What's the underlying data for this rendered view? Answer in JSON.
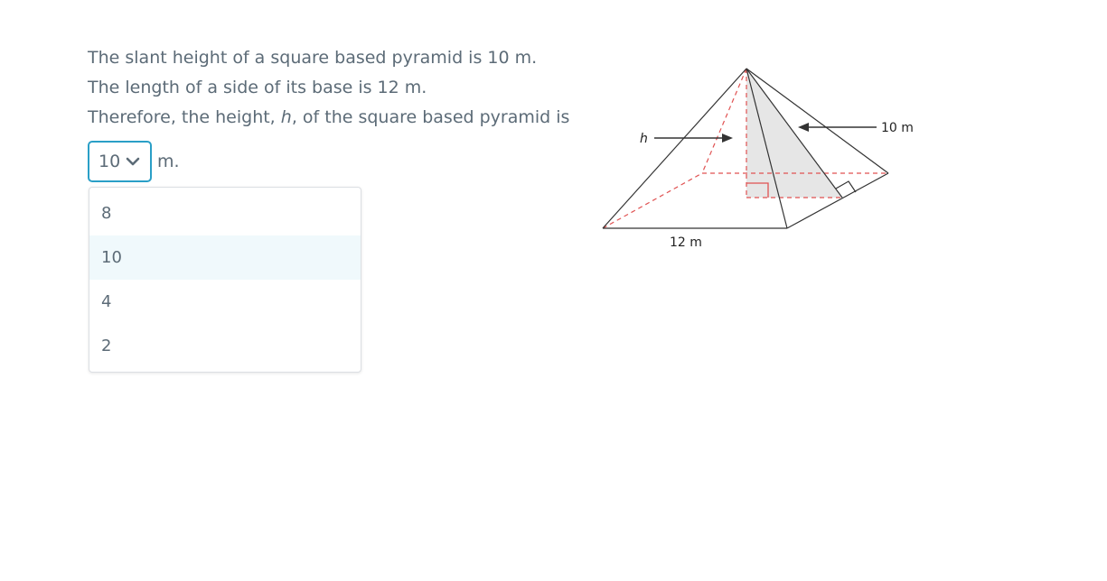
{
  "question": {
    "line1": "The slant height of a square based pyramid is 10 m.",
    "line2": "The length of a side of its base is 12 m.",
    "line3_prefix": "Therefore, the height, ",
    "line3_var": "h",
    "line3_suffix": ", of the square based pyramid is"
  },
  "answer": {
    "selected_value": "10",
    "unit_label": "m.",
    "options": [
      "8",
      "10",
      "4",
      "2"
    ]
  },
  "diagram": {
    "height_label": "h",
    "slant_label": "10 m",
    "base_label": "12 m"
  },
  "colors": {
    "text": "#5c6b77",
    "focus_border": "#2a9fc7",
    "option_highlight": "#f0f9fc",
    "dashed_red": "#e05252"
  }
}
